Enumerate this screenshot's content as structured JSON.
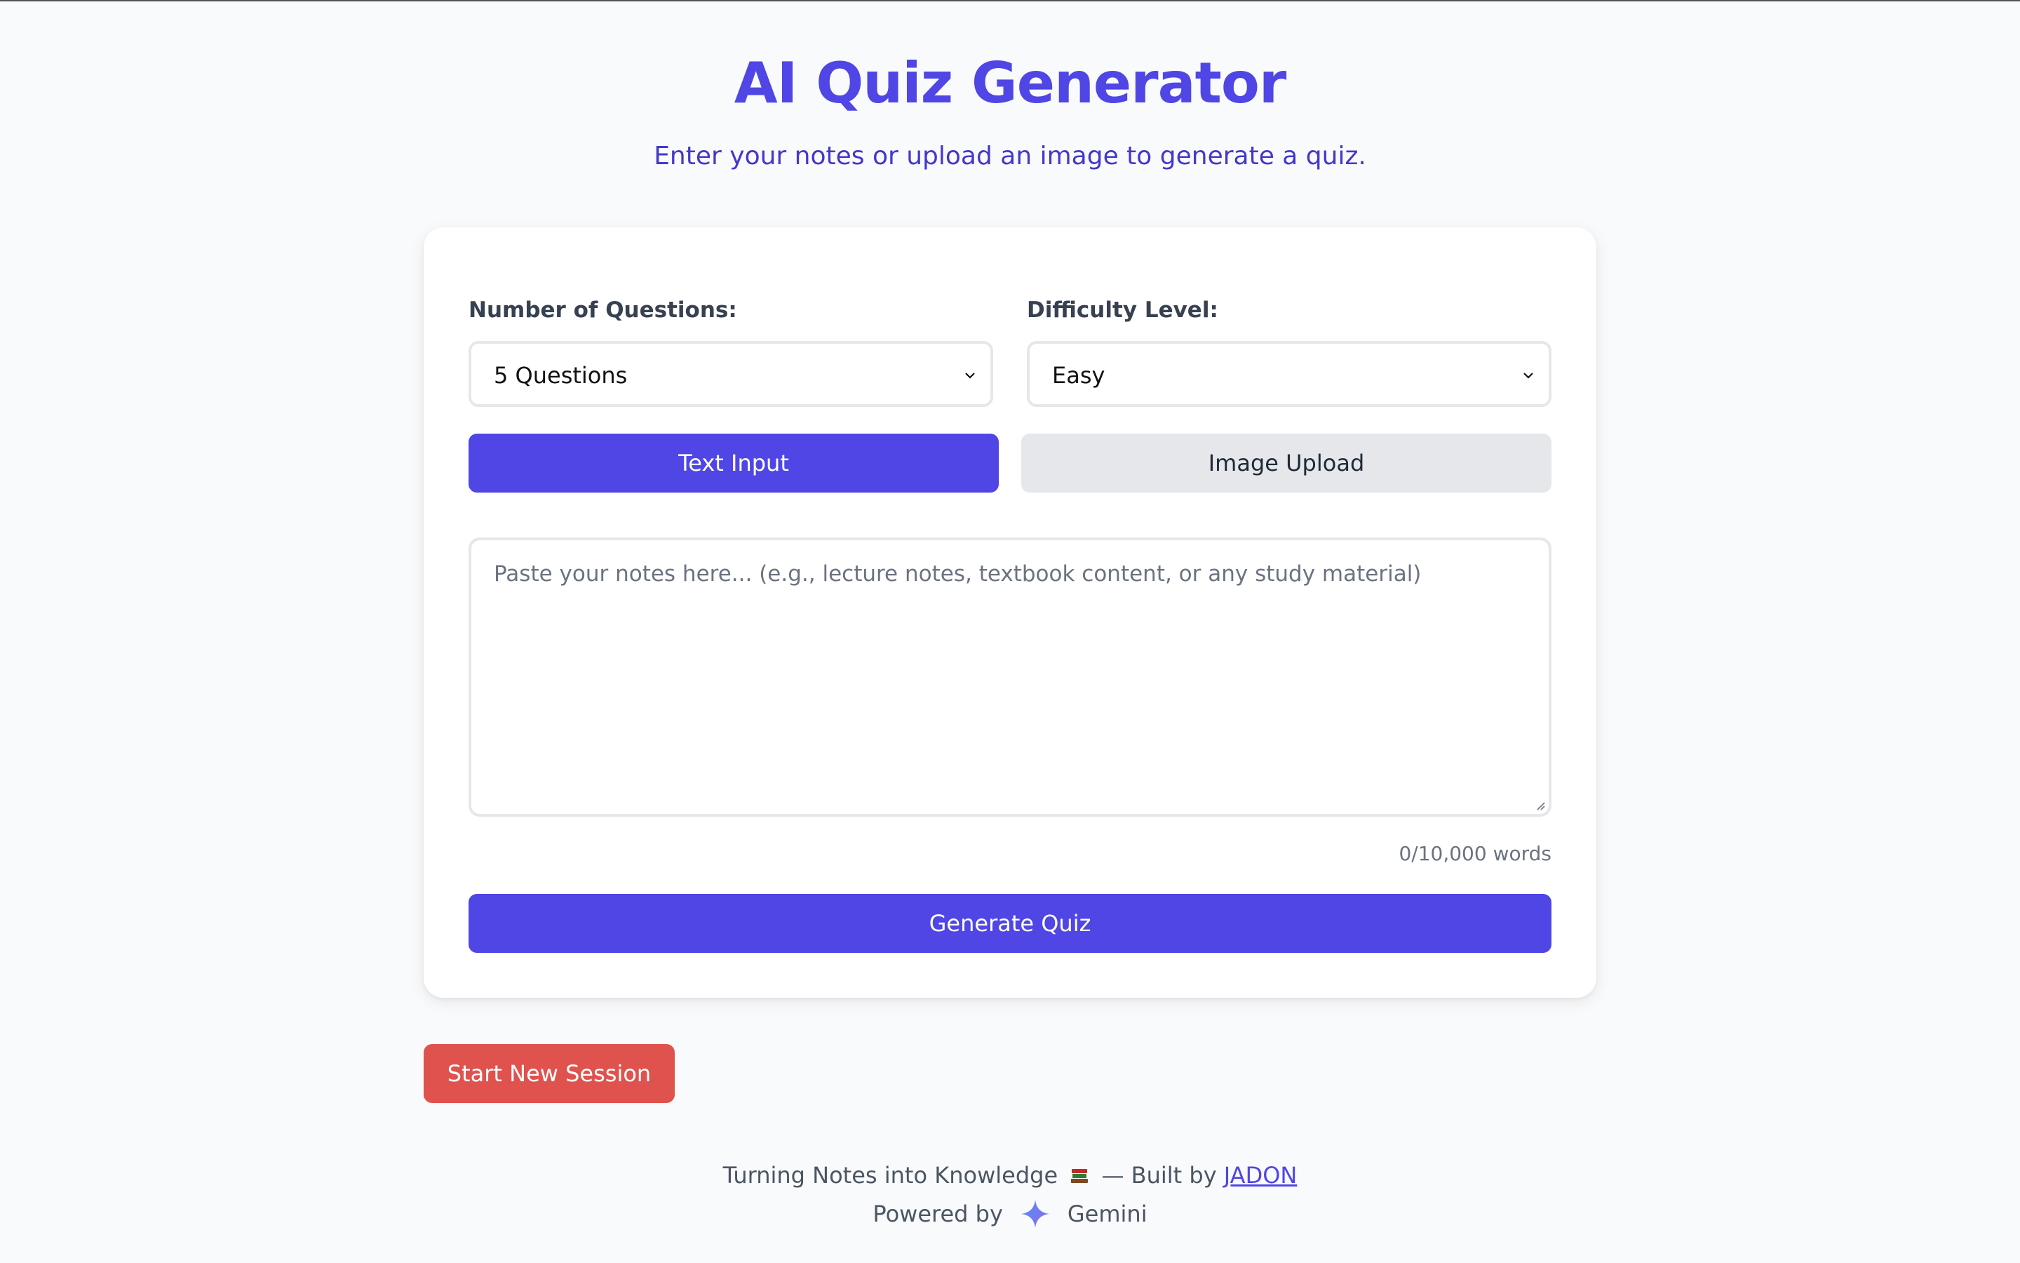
{
  "header": {
    "title": "AI Quiz Generator",
    "subtitle": "Enter your notes or upload an image to generate a quiz."
  },
  "form": {
    "questions_label": "Number of Questions:",
    "questions_value": "5 Questions",
    "difficulty_label": "Difficulty Level:",
    "difficulty_value": "Easy",
    "tab_text": "Text Input",
    "tab_image": "Image Upload",
    "notes_placeholder": "Paste your notes here... (e.g., lecture notes, textbook content, or any study material)",
    "word_count": "0/10,000 words",
    "generate_label": "Generate Quiz"
  },
  "actions": {
    "new_session_label": "Start New Session"
  },
  "footer": {
    "tagline_prefix": "Turning Notes into Knowledge",
    "tagline_mid": "— Built by",
    "author": "JADON",
    "powered_by": "Powered by",
    "powered_name": "Gemini",
    "books_icon": "books-icon",
    "gemini_icon": "gemini-sparkle-icon"
  },
  "colors": {
    "accent": "#4f46e5",
    "danger": "#e0524d",
    "background": "#f9fafb"
  }
}
